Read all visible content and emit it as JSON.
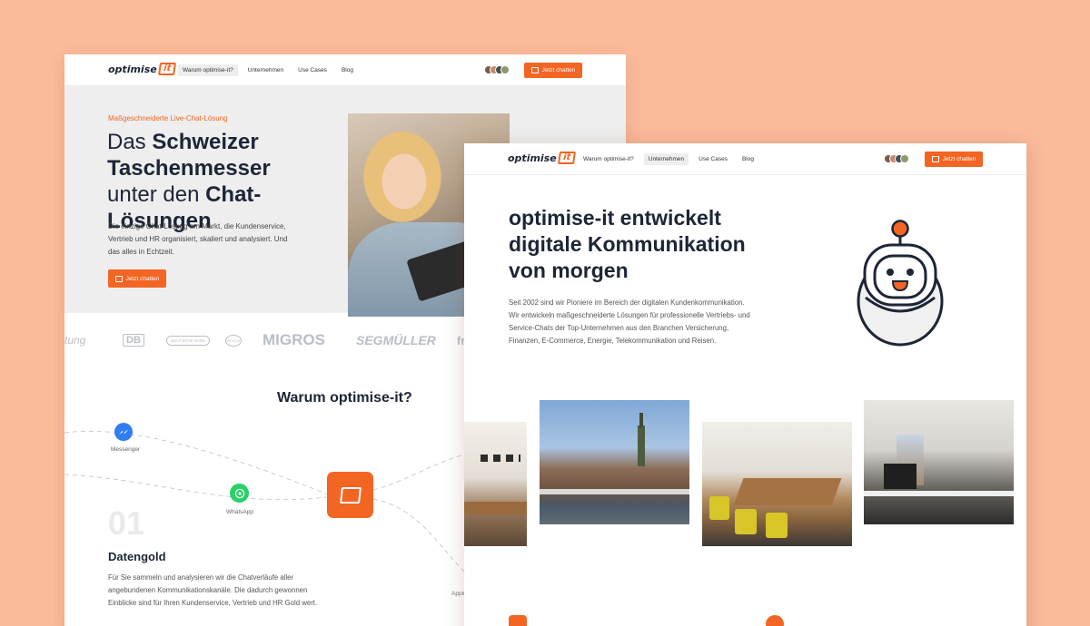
{
  "back": {
    "nav": {
      "logo_text": "optimise",
      "logo_badge": "it",
      "items": [
        {
          "label": "Warum optimise-it?",
          "active": true
        },
        {
          "label": "Unternehmen",
          "active": false
        },
        {
          "label": "Use Cases",
          "active": false
        },
        {
          "label": "Blog",
          "active": false
        }
      ],
      "cta_label": "Jetzt chatten"
    },
    "hero": {
      "eyebrow": "Maßgeschneiderte Live-Chat-Lösung",
      "title_1": "Das ",
      "title_b1": "Schweizer Taschenmesser",
      "title_2": " unter den ",
      "title_b2": "Chat-Lösungen",
      "paragraph": "Die einzige Chat-Lösung am Markt, die Kundenservice, Vertrieb und HR organisiert, skaliert und analysiert. Und das alles in Echtzeit.",
      "cta_label": "Jetzt chatten"
    },
    "logos": [
      "tung",
      "DB",
      "DEUTSCHE BANK",
      "BOSCH",
      "MIGROS",
      "SEGMÜLLER",
      "fr"
    ],
    "why_title": "Warum optimise-it?",
    "channels": {
      "messenger": "Messenger",
      "whatsapp": "WhatsApp",
      "apple": "Apple"
    },
    "feature": {
      "number": "01",
      "title": "Datengold",
      "text": "Für Sie sammeln und analysieren wir die Chatverläufe aller angebundenen Kommunikationskanäle. Die dadurch gewonnen Einblicke sind für Ihren Kundenservice, Vertrieb und HR Gold wert."
    }
  },
  "front": {
    "nav": {
      "logo_text": "optimise",
      "logo_badge": "it",
      "items": [
        {
          "label": "Warum optimise-it?",
          "active": false
        },
        {
          "label": "Unternehmen",
          "active": true
        },
        {
          "label": "Use Cases",
          "active": false
        },
        {
          "label": "Blog",
          "active": false
        }
      ],
      "cta_label": "Jetzt chatten"
    },
    "title": "optimise-it entwickelt digitale Kommunikation von morgen",
    "paragraph": "Seit 2002 sind wir Pioniere im Bereich der digitalen Kundenkommunikation. Wir entwickeln maßgeschneiderte Lösungen für professionelle Vertriebs- und Service-Chats der Top-Unternehmen aus den Branchen Versicherung, Finanzen, E-Commerce, Energie, Telekommunikation und Reisen."
  },
  "colors": {
    "accent": "#f26522",
    "background": "#fbbb9b",
    "heading": "#1d2536",
    "hero_bg": "#eeeeee"
  },
  "icons": [
    "chat-icon",
    "messenger-icon",
    "whatsapp-icon",
    "robot-mascot-icon"
  ]
}
